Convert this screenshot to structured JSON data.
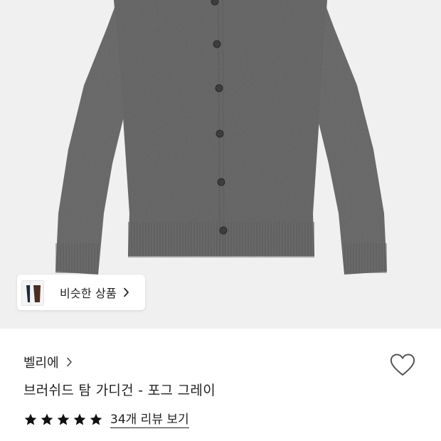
{
  "product_image": {
    "alt": ""
  },
  "similar_products": {
    "label": "비슷한 상품",
    "icon": "chevron-right-icon"
  },
  "brand": {
    "name": "벨리에",
    "icon": "chevron-right-icon"
  },
  "product": {
    "title": "브러쉬드 탐 가디건 - 포그 그레이"
  },
  "rating": {
    "stars": 5,
    "max_stars": 5,
    "review_link": "34개 리뷰 보기"
  },
  "wishlist": {
    "icon": "heart-outline-icon"
  },
  "colors": {
    "image_background": "#f0f0f0",
    "cardigan_gray": "#6f6f6f",
    "text": "#222222",
    "star": "#111111"
  }
}
